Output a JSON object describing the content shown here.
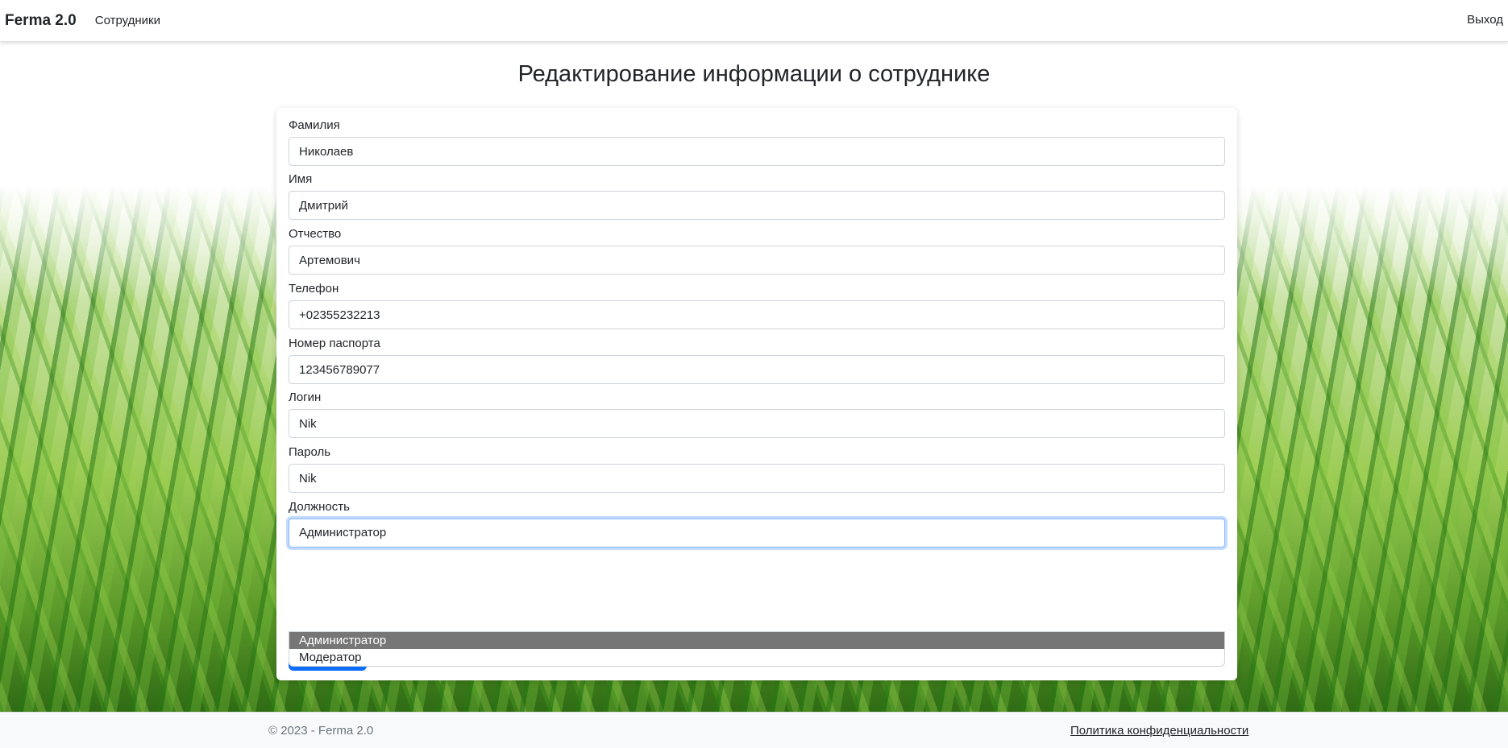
{
  "navbar": {
    "brand": "Ferma 2.0",
    "links": [
      "Сотрудники"
    ],
    "logout": "Выход"
  },
  "page_title": "Редактирование информации о сотруднике",
  "form": {
    "fields": [
      {
        "label": "Фамилия",
        "value": "Николаев"
      },
      {
        "label": "Имя",
        "value": "Дмитрий"
      },
      {
        "label": "Отчество",
        "value": "Артемович"
      },
      {
        "label": "Телефон",
        "value": "+02355232213"
      },
      {
        "label": "Номер паспорта",
        "value": "123456789077"
      },
      {
        "label": "Логин",
        "value": "Nik"
      },
      {
        "label": "Пароль",
        "value": "Nik"
      }
    ],
    "position": {
      "label": "Должность",
      "value": "Администратор",
      "options": [
        "Администратор",
        "Модератор"
      ],
      "selected_index": 0
    }
  },
  "footer": {
    "copyright": "© 2023 - Ferma 2.0",
    "privacy": "Политика конфиденциальности"
  },
  "colors": {
    "focus_border": "#86b7fe",
    "option_selected_bg": "#767676",
    "primary": "#0d6efd"
  }
}
